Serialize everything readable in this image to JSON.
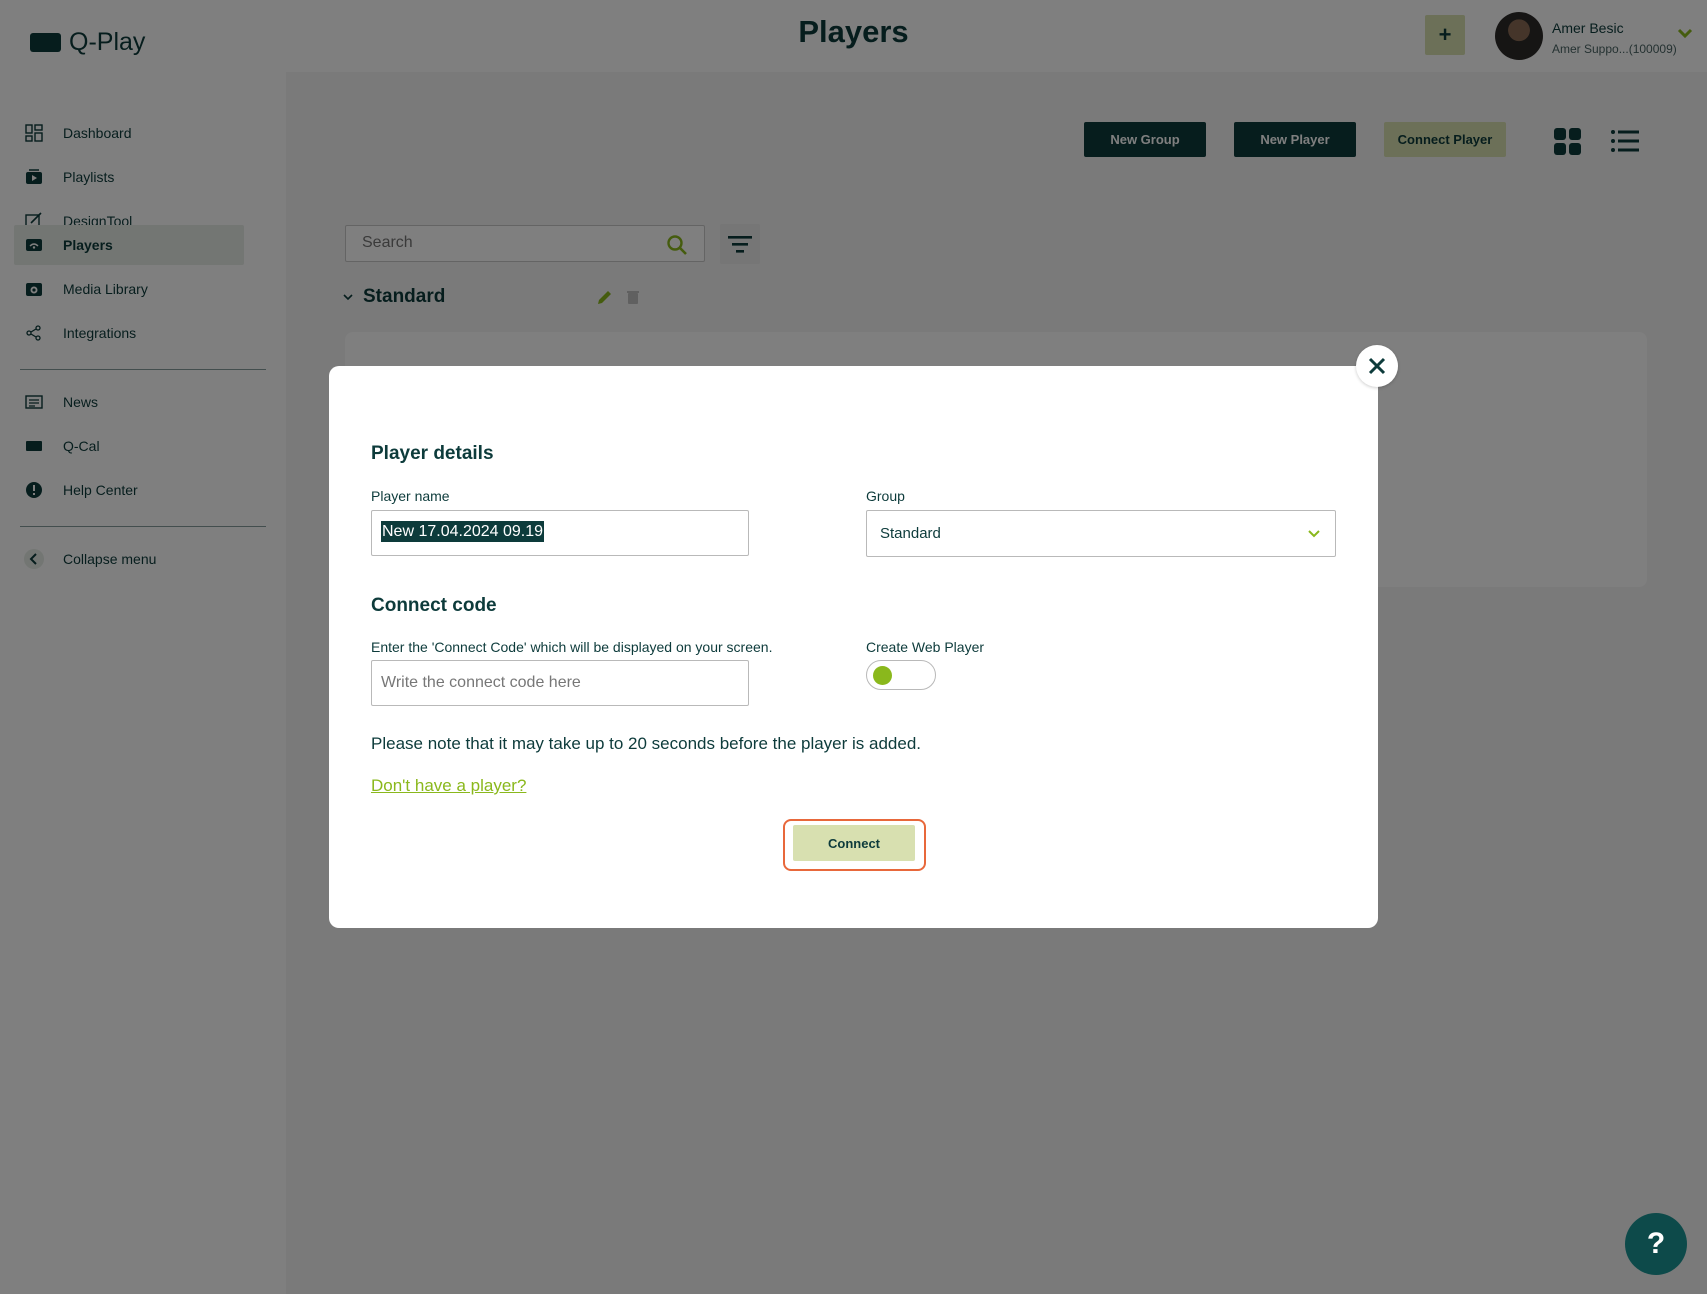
{
  "app": {
    "name": "Q-Play"
  },
  "header": {
    "title": "Players",
    "plus_label": "+",
    "user_name": "Amer Besic",
    "user_sub": "Amer Suppo...(100009)"
  },
  "sidebar": {
    "items": [
      {
        "label": "Dashboard",
        "icon": "dashboard-icon"
      },
      {
        "label": "Playlists",
        "icon": "playlist-icon"
      },
      {
        "label": "DesignTool",
        "icon": "design-icon"
      },
      {
        "label": "Players",
        "icon": "player-icon"
      },
      {
        "label": "Media Library",
        "icon": "media-icon"
      },
      {
        "label": "Integrations",
        "icon": "share-icon"
      },
      {
        "label": "News",
        "icon": "news-icon"
      },
      {
        "label": "Q-Cal",
        "icon": "calendar-icon"
      },
      {
        "label": "Help Center",
        "icon": "info-icon"
      },
      {
        "label": "Collapse menu",
        "icon": "chevron-left-icon"
      }
    ],
    "active": "Players"
  },
  "toolbar": {
    "new_group": "New Group",
    "new_player": "New Player",
    "connect_player": "Connect Player"
  },
  "search": {
    "placeholder": "Search"
  },
  "group": {
    "name": "Standard"
  },
  "modal": {
    "player_details_title": "Player details",
    "player_name_label": "Player name",
    "player_name_value": "New 17.04.2024 09.19",
    "group_label": "Group",
    "group_value": "Standard",
    "connect_code_title": "Connect code",
    "connect_code_label": "Enter the 'Connect Code' which will be displayed on your screen.",
    "connect_code_placeholder": "Write the connect code here",
    "web_player_label": "Create Web Player",
    "web_player_enabled": false,
    "note": "Please note that it may take up to 20 seconds before the player is added.",
    "no_player_link": "Don't have a player?",
    "connect_button": "Connect"
  },
  "help_fab": {
    "label": "?"
  },
  "colors": {
    "brand_dark": "#0d3b3b",
    "accent_light": "#d8e0b0",
    "accent_green": "#8ab81c",
    "highlight_ring": "#e8683b"
  }
}
